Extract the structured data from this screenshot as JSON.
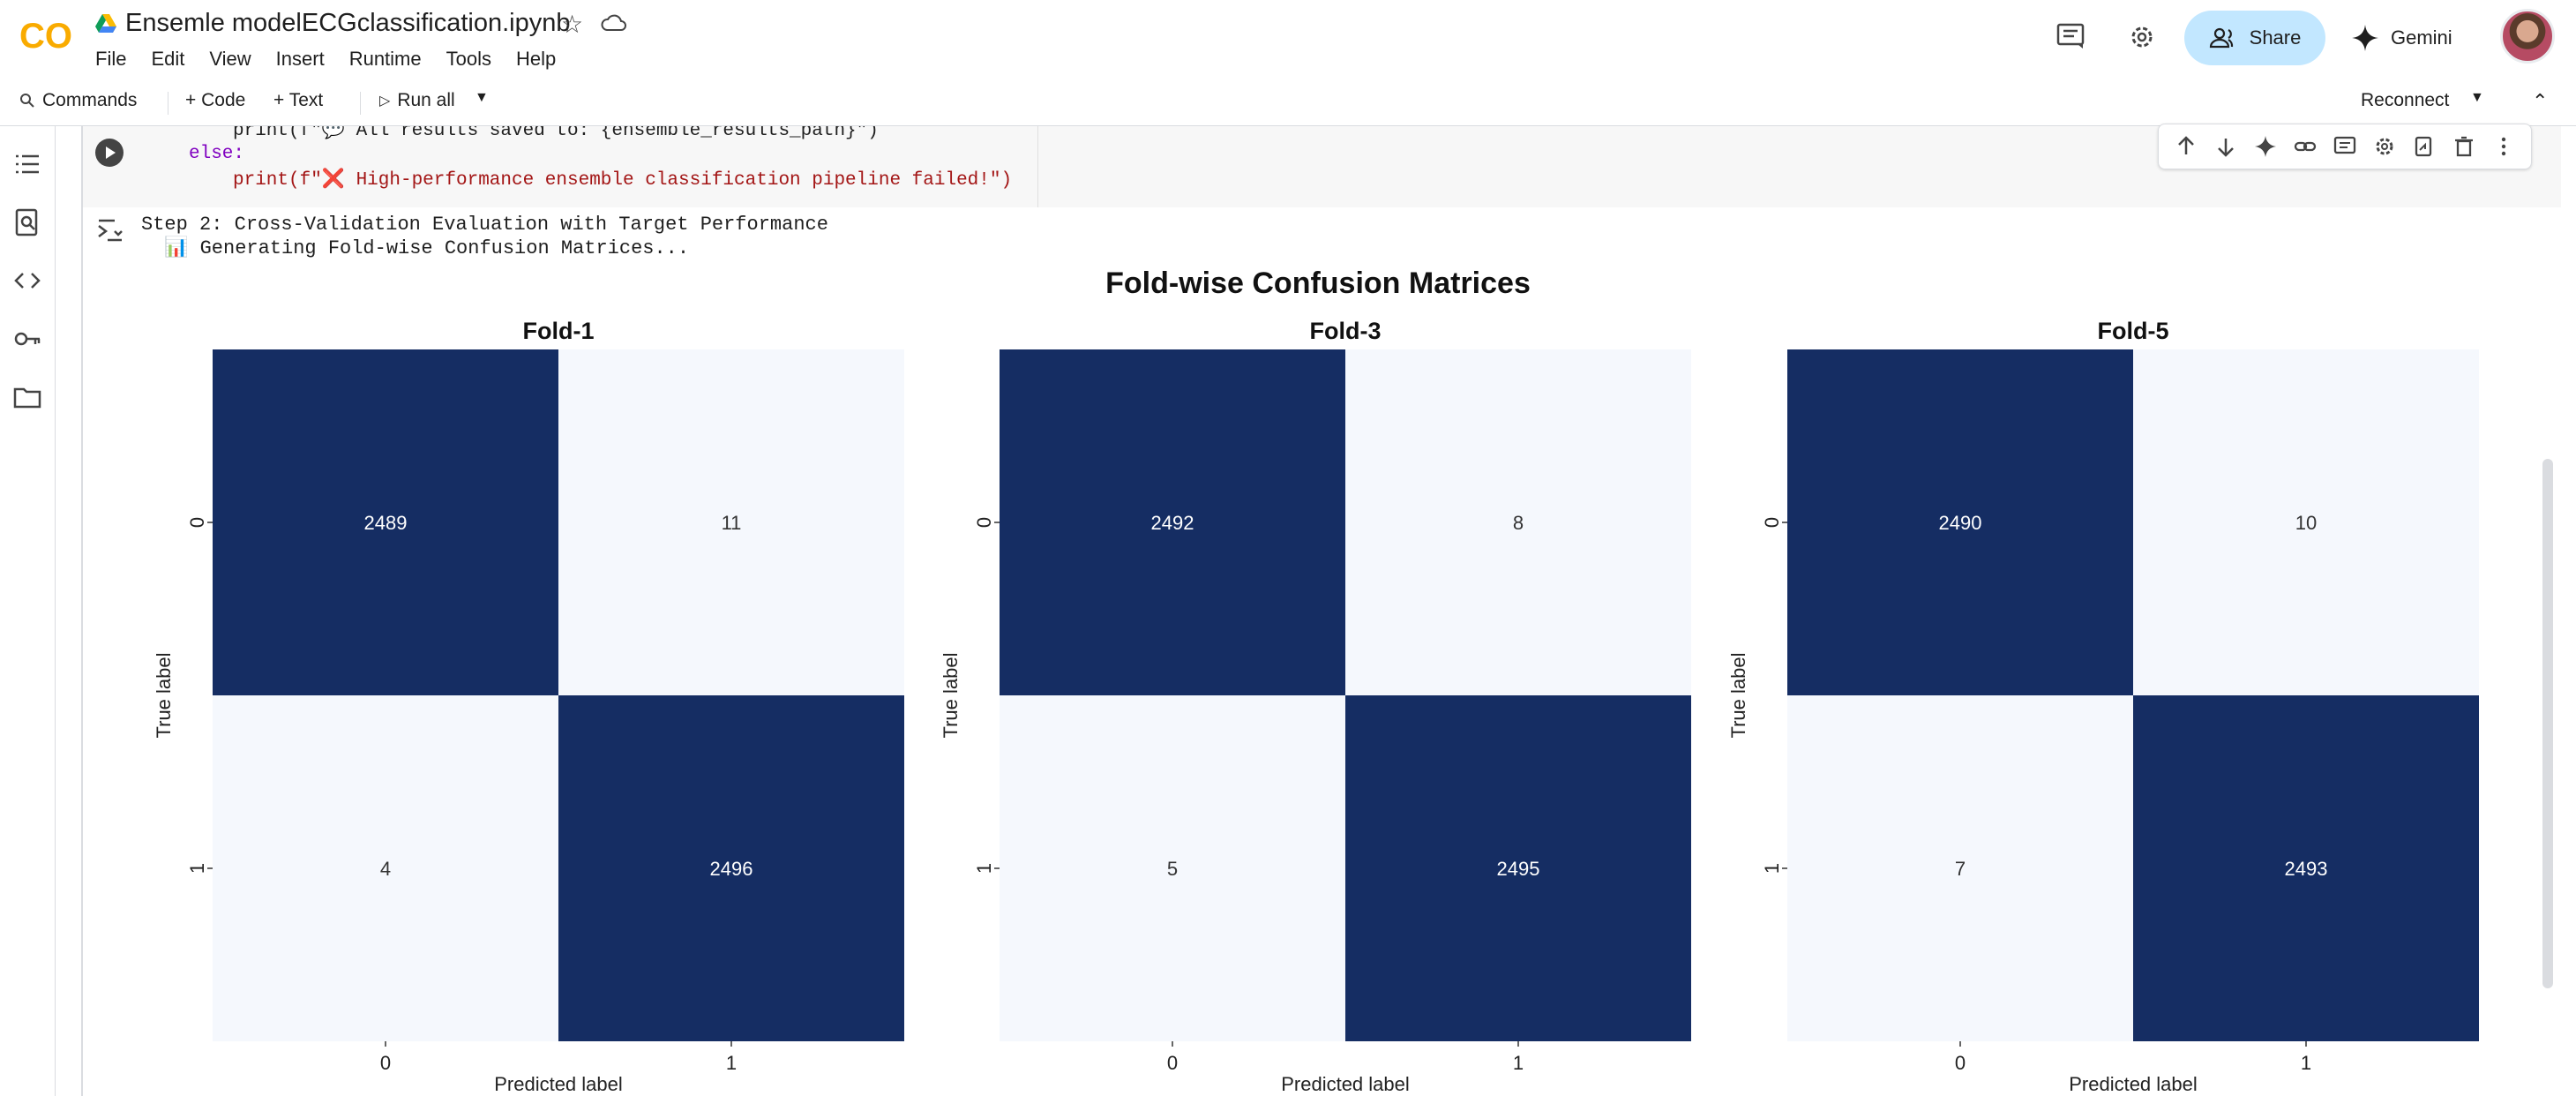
{
  "header": {
    "logo_text": "CO",
    "title": "Ensemle modelECGclassification.ipynb",
    "share_label": "Share",
    "gemini_label": "Gemini"
  },
  "menu": [
    "File",
    "Edit",
    "View",
    "Insert",
    "Runtime",
    "Tools",
    "Help"
  ],
  "toolbar": {
    "commands": "Commands",
    "code": "+ Code",
    "text": "+ Text",
    "run_all": "Run all",
    "reconnect": "Reconnect"
  },
  "code": {
    "line1": "print(f\"💬 All results saved to: {ensemble_results_path}\")",
    "line2": "else:",
    "line3": "print(f\"❌ High-performance ensemble classification pipeline failed!\")"
  },
  "output": {
    "line1": "Step 2: Cross-Validation Evaluation with Target Performance",
    "line2": "📊 Generating Fold-wise Confusion Matrices..."
  },
  "colors": {
    "dark": "#152d63",
    "light": "#f5f8fd",
    "accent": "#c2e7ff"
  },
  "chart_data": {
    "type": "heatmap",
    "title": "Fold-wise Confusion Matrices",
    "panels": [
      {
        "title": "Fold-1",
        "matrix": [
          [
            2489,
            11
          ],
          [
            4,
            2496
          ]
        ]
      },
      {
        "title": "Fold-3",
        "matrix": [
          [
            2492,
            8
          ],
          [
            5,
            2495
          ]
        ]
      },
      {
        "title": "Fold-5",
        "matrix": [
          [
            2490,
            10
          ],
          [
            7,
            2493
          ]
        ]
      }
    ],
    "xlabel": "Predicted label",
    "ylabel": "True label",
    "xticks": [
      "0",
      "1"
    ],
    "yticks": [
      "0",
      "1"
    ]
  }
}
